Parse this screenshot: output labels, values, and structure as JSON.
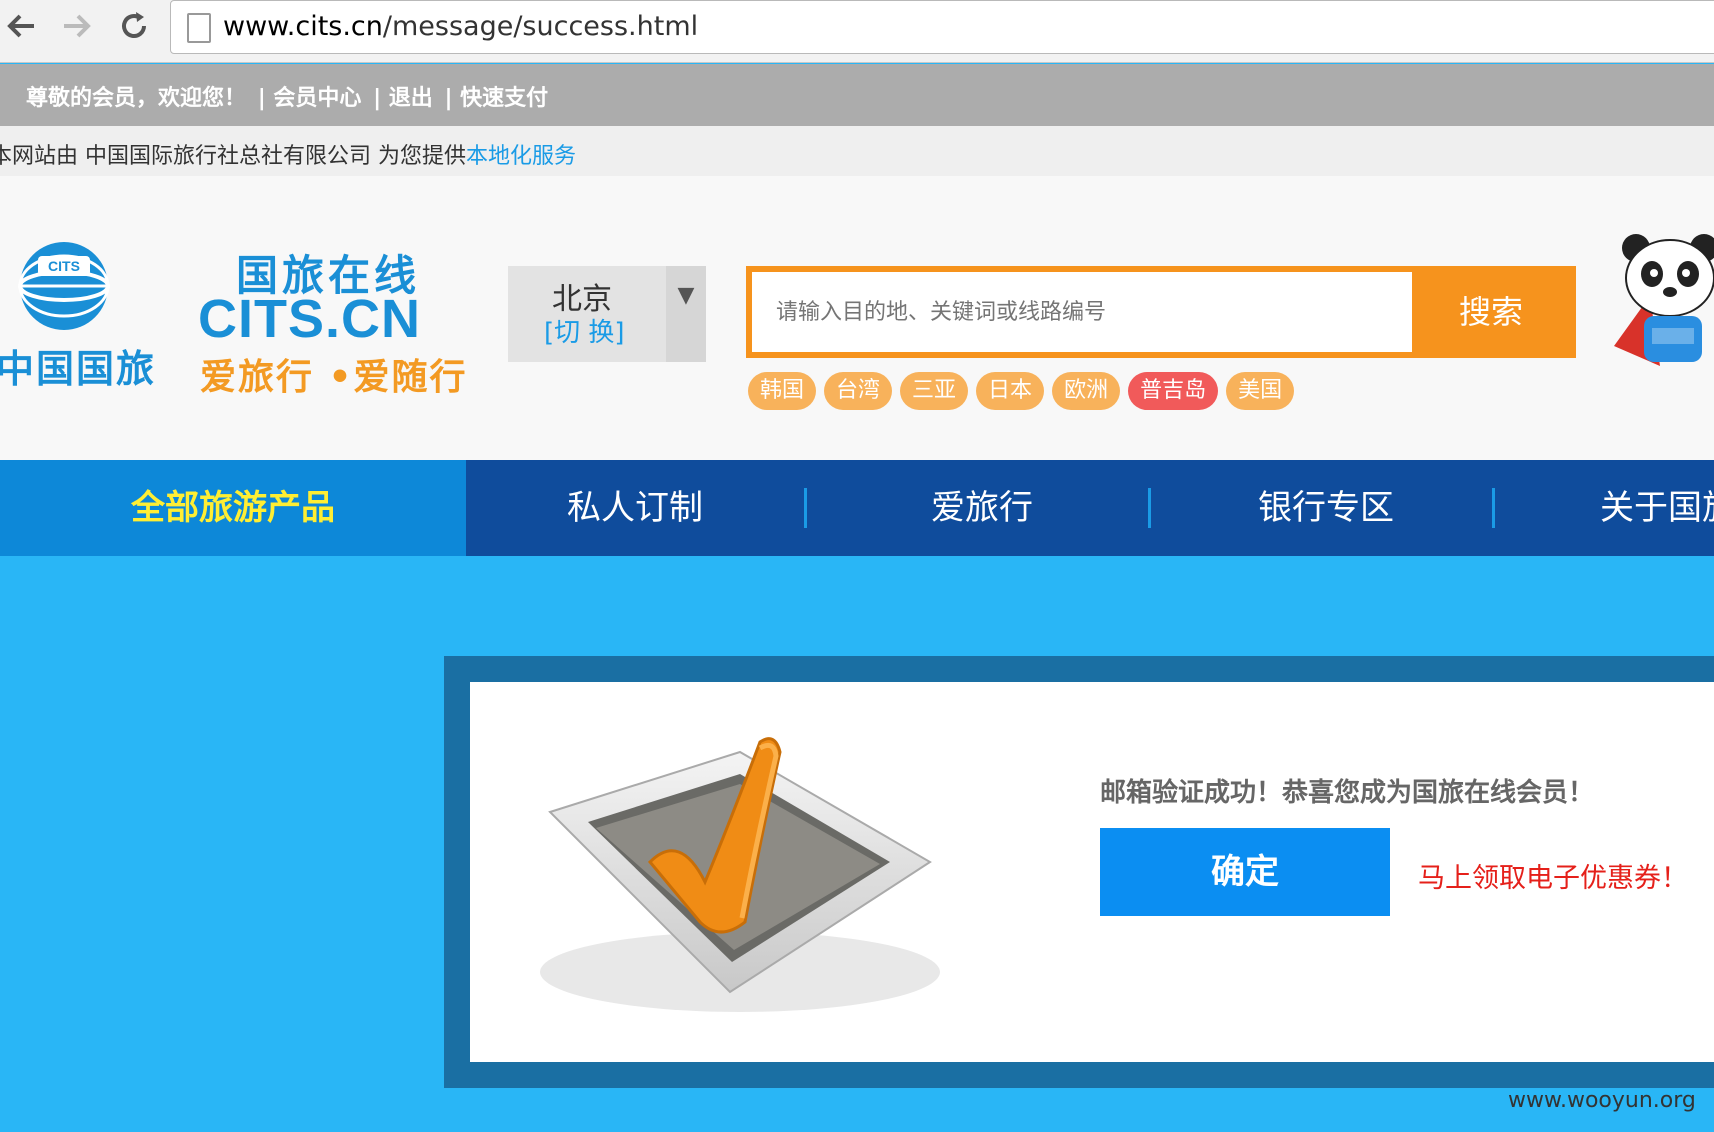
{
  "browser": {
    "url_host": "www.cits.cn",
    "url_path": "/message/success.html",
    "back_icon": "back-arrow-icon",
    "forward_icon": "forward-arrow-icon",
    "reload_icon": "reload-icon"
  },
  "member_bar": {
    "greeting": "尊敬的会员，欢迎您！",
    "links": [
      "| 会员中心",
      "| 退出",
      "| 快速支付"
    ]
  },
  "notice": {
    "text": "本网站由 中国国际旅行社总社有限公司 为您提供",
    "link": "本地化服务"
  },
  "header": {
    "logo1_text": "中国国旅",
    "logo2_top": "国旅在线",
    "logo2_mid": "CITS.CN",
    "logo2_bot": "爱旅行 •爱随行",
    "city": "北京",
    "city_switch": "[切 换]",
    "search_placeholder": "请输入目的地、关键词或线路编号",
    "search_button": "搜索",
    "hot_tags": [
      "韩国",
      "台湾",
      "三亚",
      "日本",
      "欧洲",
      "普吉岛",
      "美国"
    ]
  },
  "nav": {
    "items": [
      "全部旅游产品",
      "私人订制",
      "爱旅行",
      "银行专区",
      "关于国旅"
    ]
  },
  "content": {
    "success_message": "邮箱验证成功！恭喜您成为国旅在线会员！",
    "ok_button": "确定",
    "coupon_link": "马上领取电子优惠券！"
  },
  "watermark": "www.wooyun.org",
  "colors": {
    "accent_blue": "#0f4c9c",
    "page_bg": "#29b6f6",
    "orange": "#f6931d"
  }
}
